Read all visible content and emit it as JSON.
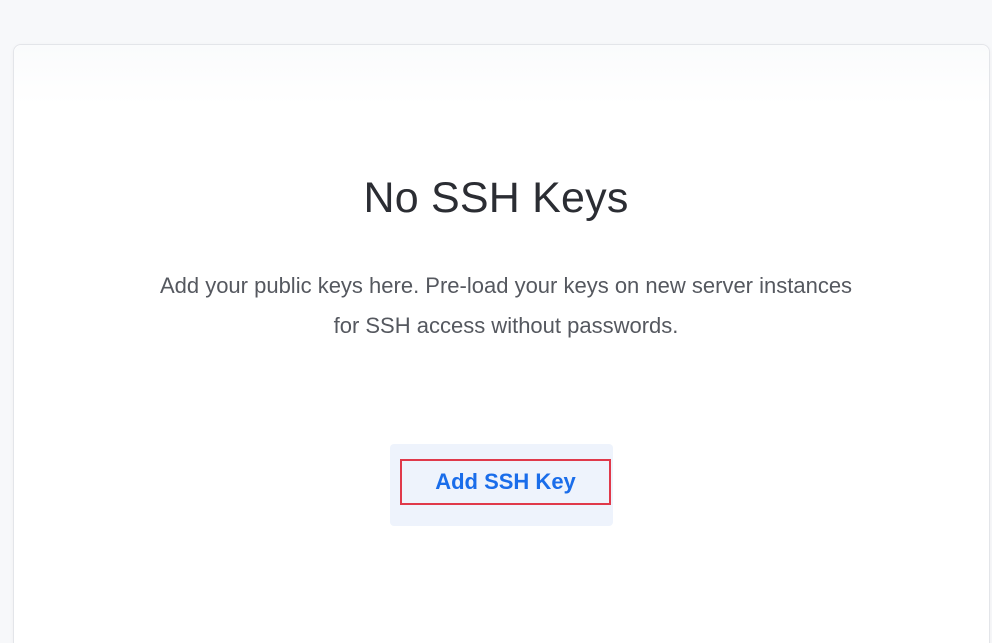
{
  "empty_state": {
    "title": "No SSH Keys",
    "description_line1": "Add your public keys here. Pre-load your keys on new server instances",
    "description_line2": "for SSH access without passwords.",
    "add_button_label": "Add SSH Key"
  },
  "colors": {
    "accent": "#1a6dea",
    "highlight_border": "#e0394a",
    "button_background": "#eef3fc"
  }
}
